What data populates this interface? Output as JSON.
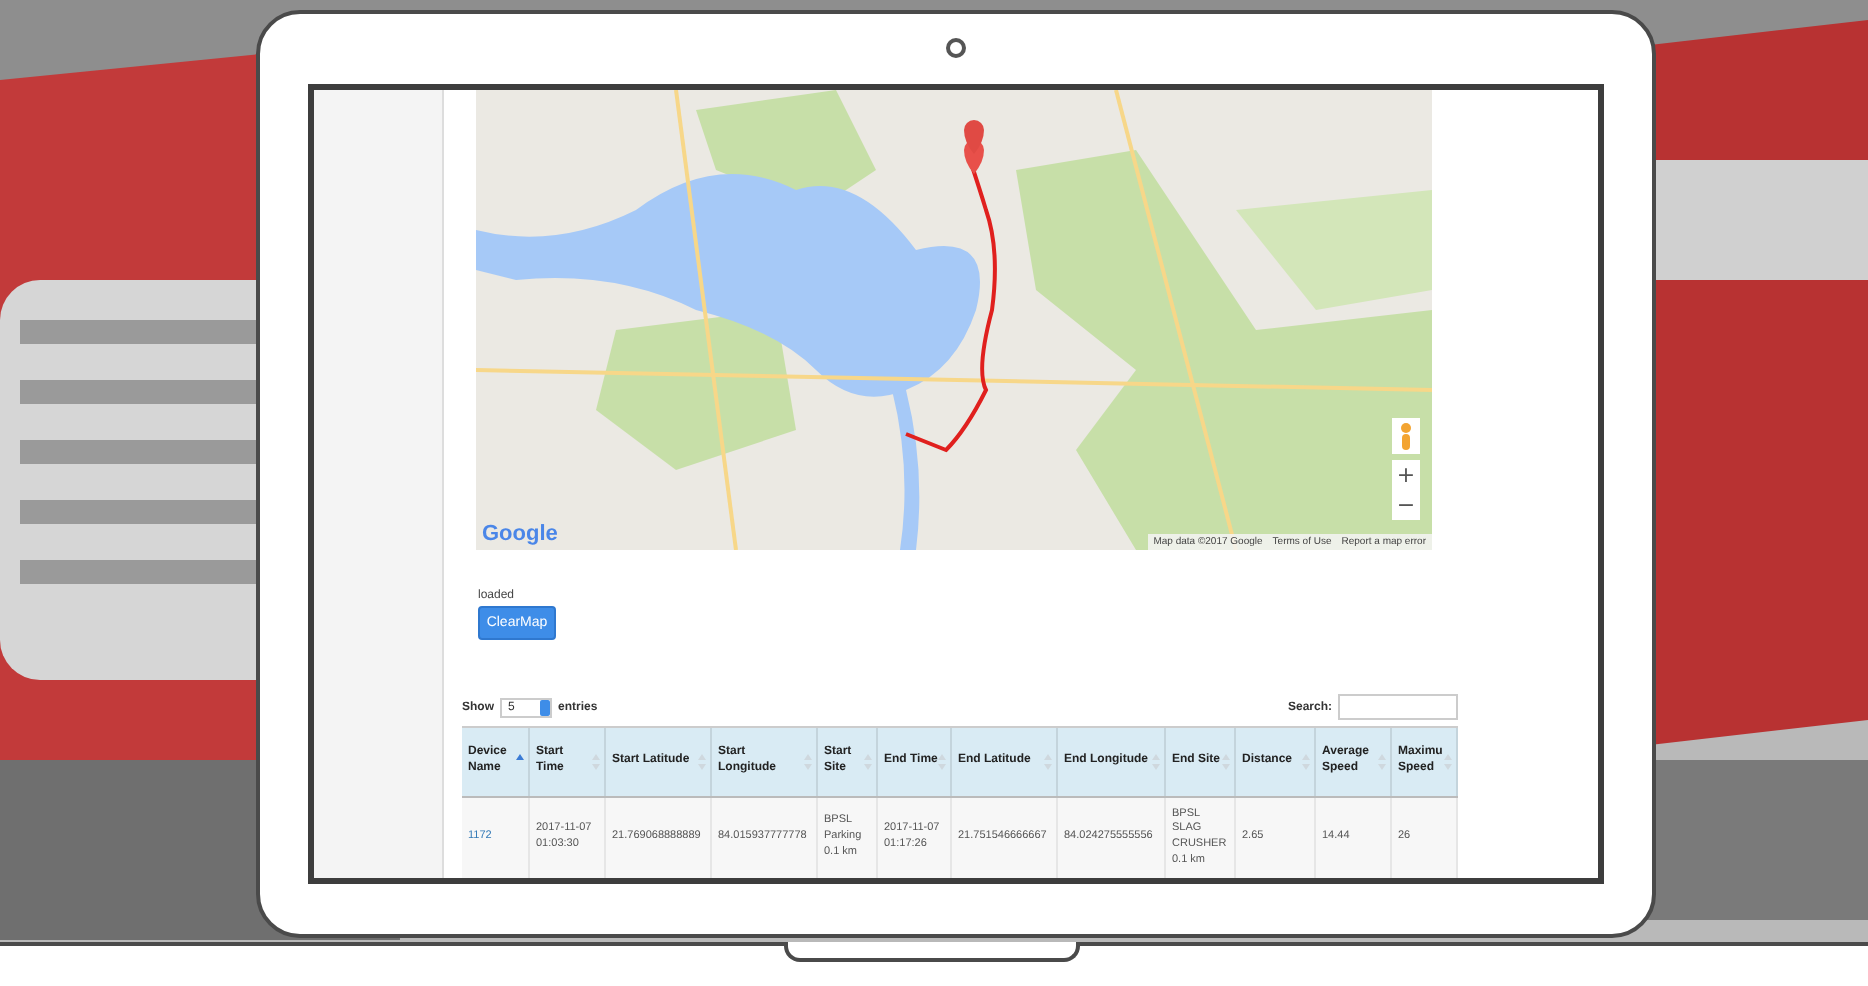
{
  "map": {
    "logo": "Google",
    "zoom_in": "+",
    "zoom_out": "−",
    "attribution": [
      "Map data ©2017 Google",
      "Terms of Use",
      "Report a map error"
    ]
  },
  "status": "loaded",
  "clear_button": "ClearMap",
  "length": {
    "label_before": "Show",
    "value": "5",
    "label_after": "entries"
  },
  "search": {
    "label": "Search:"
  },
  "table": {
    "columns": [
      {
        "label": "Device Name",
        "sorted": true
      },
      {
        "label": "Start Time",
        "sorted": false
      },
      {
        "label": "Start Latitude",
        "sorted": false
      },
      {
        "label": "Start Longitude",
        "sorted": false
      },
      {
        "label": "Start Site",
        "sorted": false
      },
      {
        "label": "End Time",
        "sorted": false
      },
      {
        "label": "End Latitude",
        "sorted": false
      },
      {
        "label": "End Longitude",
        "sorted": false
      },
      {
        "label": "End Site",
        "sorted": false
      },
      {
        "label": "Distance",
        "sorted": false
      },
      {
        "label": "Average Speed",
        "sorted": false
      },
      {
        "label": "Maximu Speed",
        "sorted": false
      }
    ],
    "rows": [
      {
        "cells": [
          {
            "text": "1172",
            "kind": "link"
          },
          {
            "text": "2017-11-07 01:03:30",
            "kind": "text"
          },
          {
            "text": "21.769068888889",
            "kind": "text"
          },
          {
            "text": "84.015937777778",
            "kind": "text"
          },
          {
            "text": "BPSL Parking 0.1 km",
            "kind": "text"
          },
          {
            "text": "2017-11-07 01:17:26",
            "kind": "text"
          },
          {
            "text": "21.751546666667",
            "kind": "text"
          },
          {
            "text": "84.024275555556",
            "kind": "text"
          },
          {
            "text": "BPSL SLAG CRUSHER 0.1 km",
            "kind": "text"
          },
          {
            "text": "2.65",
            "kind": "text"
          },
          {
            "text": "14.44",
            "kind": "text"
          },
          {
            "text": "26",
            "kind": "text"
          }
        ]
      }
    ]
  }
}
